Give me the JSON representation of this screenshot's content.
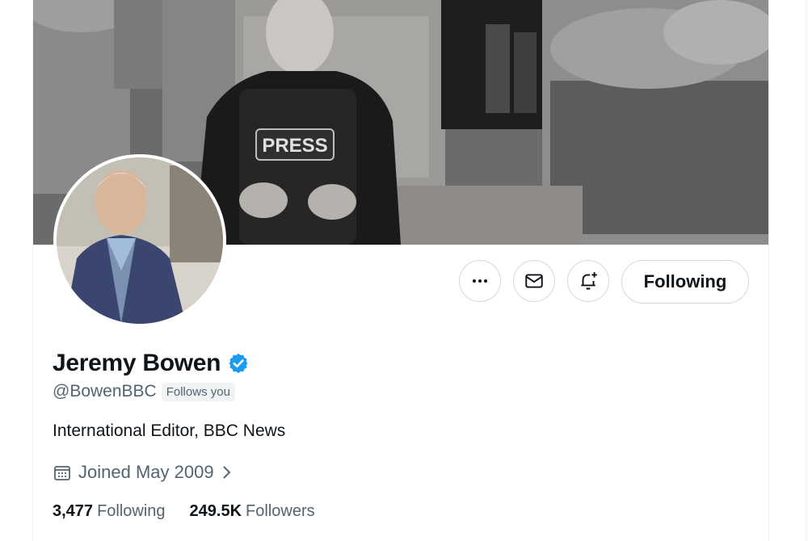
{
  "banner": {
    "press_label": "PRESS"
  },
  "actions": {
    "more_icon": "more-icon",
    "message_icon": "envelope-icon",
    "notify_icon": "bell-plus-icon",
    "follow_label": "Following"
  },
  "profile": {
    "name": "Jeremy Bowen",
    "handle": "@BowenBBC",
    "follows_you": "Follows you",
    "bio": "International Editor, BBC News",
    "joined": "Joined May 2009",
    "following_count": "3,477",
    "following_label": "Following",
    "followers_count": "249.5K",
    "followers_label": "Followers"
  },
  "colors": {
    "verified": "#1d9bf0",
    "secondary_text": "#536471",
    "border": "#cfd9de"
  }
}
